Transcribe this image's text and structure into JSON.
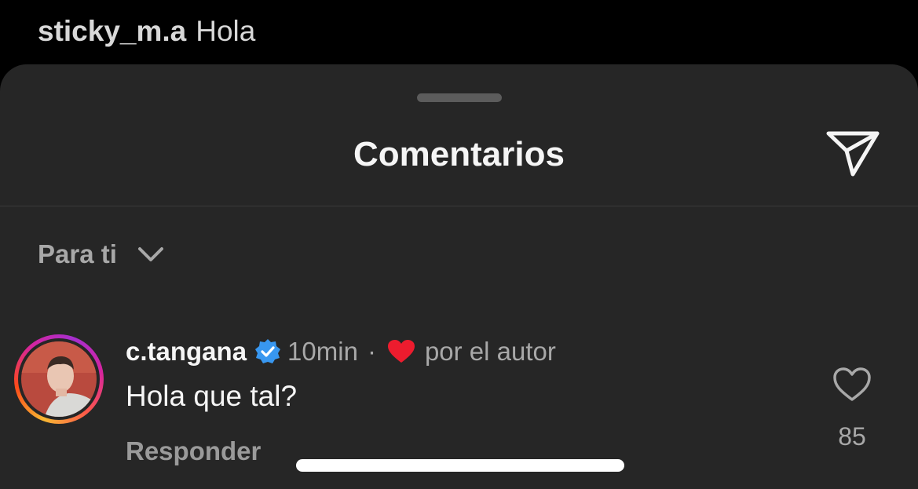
{
  "caption": {
    "username": "sticky_m.a",
    "text": "Hola"
  },
  "sheet": {
    "title": "Comentarios",
    "share_icon": "paper-plane-icon",
    "sort": {
      "label": "Para ti",
      "icon": "chevron-down-icon"
    }
  },
  "comment": {
    "username": "c.tangana",
    "verified": true,
    "verified_color": "#3897f0",
    "time": "10min",
    "separator": "·",
    "liked_by_author_text": "por el autor",
    "liked_heart_color": "#ed1c2e",
    "text": "Hola que tal?",
    "reply_label": "Responder",
    "like_count": "85",
    "avatar_ring_colors": [
      "#f7b733",
      "#fc4a1a",
      "#d6249f",
      "#a62fcf"
    ]
  },
  "colors": {
    "background": "#000000",
    "sheet": "#262626",
    "primary_text": "#f5f5f5",
    "secondary_text": "#a8a8a8"
  }
}
